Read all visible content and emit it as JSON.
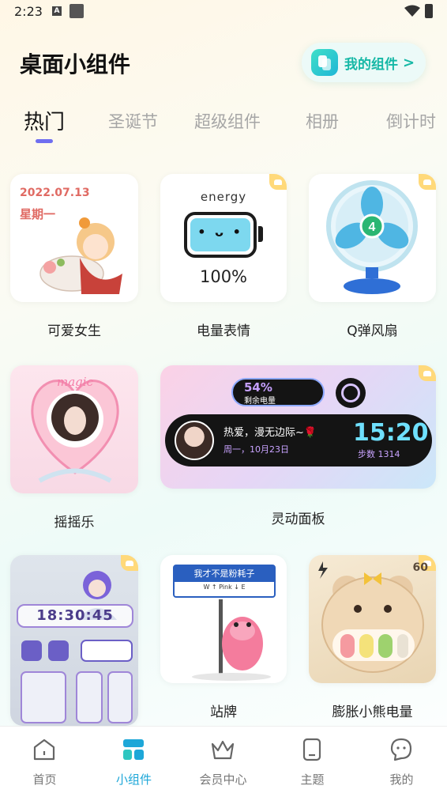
{
  "status_bar": {
    "time": "2:23",
    "notif_letter": "A"
  },
  "header": {
    "title": "桌面小组件",
    "my_widgets_label": "我的组件",
    "my_widgets_chevron": ">"
  },
  "tabs": [
    {
      "label": "热门",
      "active": true
    },
    {
      "label": "圣诞节"
    },
    {
      "label": "超级组件"
    },
    {
      "label": "相册"
    },
    {
      "label": "倒计时"
    }
  ],
  "widgets": [
    {
      "label": "可爱女生",
      "date": "2022.07.13",
      "weekday": "星期一"
    },
    {
      "label": "电量表情",
      "energy_text": "energy",
      "face": "• ᴗ •",
      "percent": "100%",
      "vip": true
    },
    {
      "label": "Q弹风扇",
      "fan_level": "4",
      "vip": true
    },
    {
      "label": "摇摇乐",
      "magic_text": "magic"
    },
    {
      "label": "灵动面板",
      "vip": true,
      "battery_pct": "54%",
      "battery_sub": "剩余电量",
      "message": "热爱，漫无边际~🌹",
      "date": "周一，10月23日",
      "time": "15:20",
      "steps": "步数 1314"
    },
    {
      "label": "",
      "lock_time": "18:30:45",
      "vip": true
    },
    {
      "label": "站牌",
      "sign_title": "我才不是粉耗子",
      "sign_sub": "W ↑ Pink ↓ E"
    },
    {
      "label": "膨胀小熊电量",
      "percent": "60",
      "vip": true
    }
  ],
  "bottom_nav": [
    {
      "label": "首页",
      "icon": "home-icon"
    },
    {
      "label": "小组件",
      "icon": "widgets-icon",
      "active": true
    },
    {
      "label": "会员中心",
      "icon": "crown-icon"
    },
    {
      "label": "主题",
      "icon": "theme-icon"
    },
    {
      "label": "我的",
      "icon": "profile-icon"
    }
  ],
  "colors": {
    "accent": "#16b8a6",
    "tab_indicator": "#6f6ef0",
    "nav_active": "#1da7d8"
  }
}
